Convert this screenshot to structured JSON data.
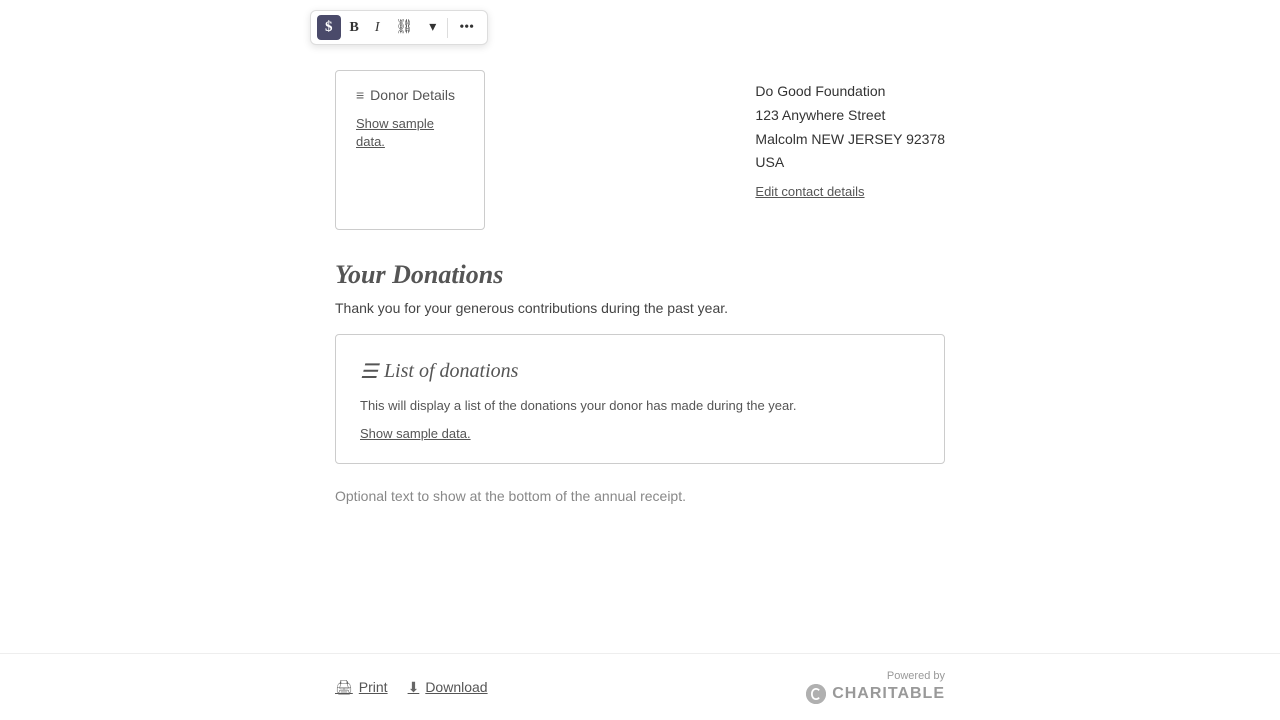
{
  "toolbar": {
    "dollar_label": "$",
    "bold_label": "B",
    "italic_label": "I",
    "link_label": "🔗",
    "chevron_label": "▾",
    "more_label": "···"
  },
  "donor_details_block": {
    "label": "Donor Details",
    "show_sample_label": "Show sample data."
  },
  "address": {
    "name": "Do Good Foundation",
    "street": "123 Anywhere Street",
    "city_state_zip": "Malcolm NEW JERSEY 92378",
    "country": "USA",
    "edit_link": "Edit contact details"
  },
  "donations_section": {
    "title": "Your Donations",
    "subtitle": "Thank you for your generous contributions during the past year."
  },
  "donations_block": {
    "title": "List of donations",
    "description": "This will display a list of the donations your donor has made during the year.",
    "show_sample_label": "Show sample data."
  },
  "optional_text": "Optional text to show at the bottom of the annual receipt.",
  "footer": {
    "print_label": "Print",
    "download_label": "Download",
    "powered_by_label": "Powered by",
    "charitable_label": "CHARITABLE"
  }
}
